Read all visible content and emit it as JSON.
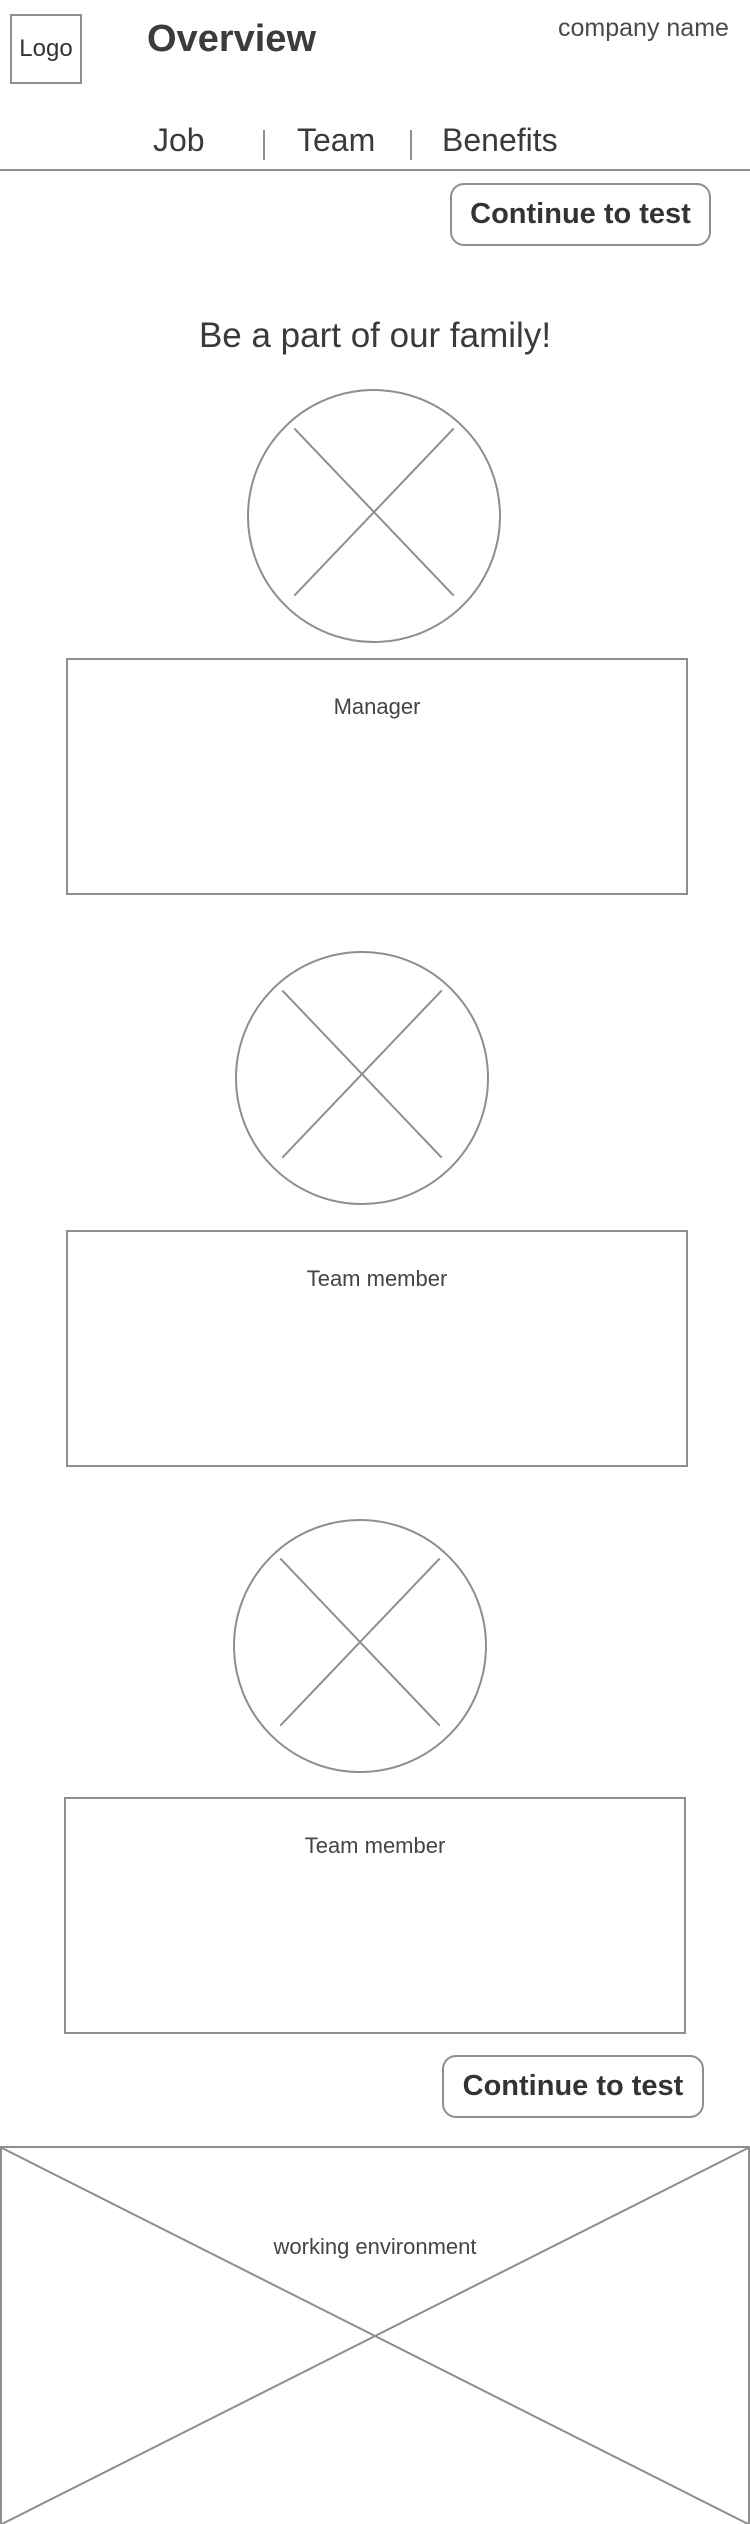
{
  "header": {
    "logo_label": "Logo",
    "title": "Overview",
    "company_name": "company name"
  },
  "nav": {
    "tabs": [
      {
        "label": "Job"
      },
      {
        "label": "Team"
      },
      {
        "label": "Benefits"
      }
    ]
  },
  "actions": {
    "continue_top": "Continue to test",
    "continue_bottom": "Continue to test"
  },
  "main": {
    "headline": "Be a part of our family!",
    "members": [
      {
        "role": "Manager"
      },
      {
        "role": "Team member"
      },
      {
        "role": "Team member"
      }
    ],
    "environment_label": "working environment"
  },
  "colors": {
    "stroke": "#8e8e8e",
    "text": "#3a3a3a",
    "background": "#ffffff"
  },
  "icons": {
    "image_placeholder": "image-placeholder-icon"
  }
}
